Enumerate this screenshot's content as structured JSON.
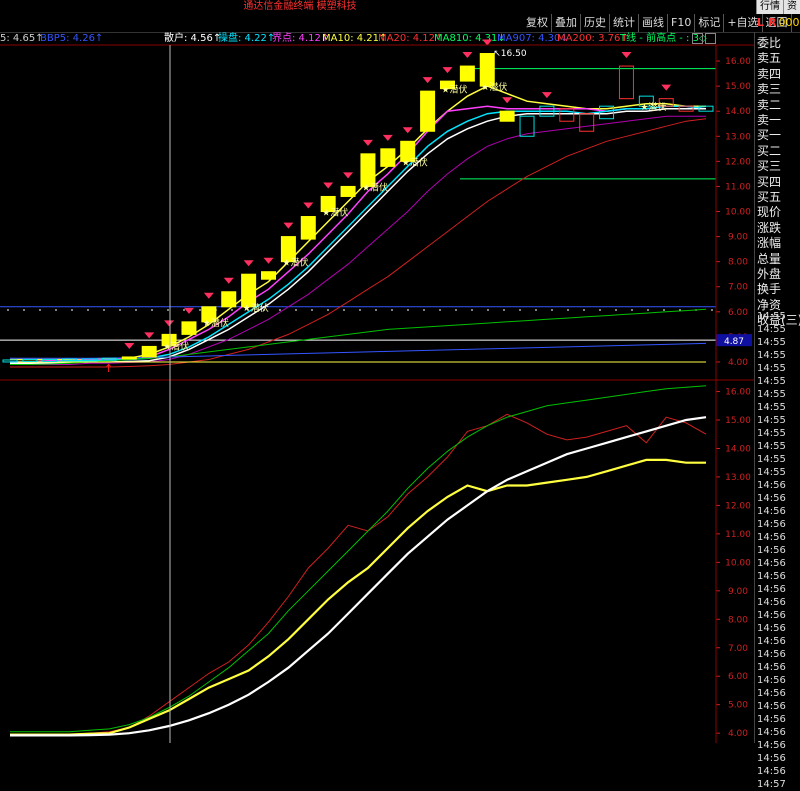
{
  "app_title": "通达信金融终端  模塑科技",
  "top_buttons": [
    "行情",
    "资"
  ],
  "toolbar": {
    "tabs": [
      "复权",
      "叠加",
      "历史",
      "统计",
      "画线",
      "F10",
      "标记",
      "+自选",
      "返回"
    ],
    "l_label": "L",
    "r_label": "R",
    "code": "0007"
  },
  "indicators": [
    {
      "text": "5: 4.65↑",
      "color": "#cccccc"
    },
    {
      "text": "BBP5: 4.26↑",
      "color": "#3355ff"
    },
    {
      "text": "散户: 4.56↑",
      "color": "#ffffff"
    },
    {
      "text": "操盘: 4.22↑",
      "color": "#00e5ff"
    },
    {
      "text": "界点: 4.12↑",
      "color": "#ff40ff"
    },
    {
      "text": "MA10: 4.21↑",
      "color": "#ffff40"
    },
    {
      "text": "MA20: 4.12↑",
      "color": "#ff3030"
    },
    {
      "text": "MA810: 4.31↓",
      "color": "#00ff60"
    },
    {
      "text": "MA907: 4.30↓",
      "color": "#3355ff"
    },
    {
      "text": "MA200: 3.76↑",
      "color": "#ff3030"
    },
    {
      "text": "T线 - 前高点 - : 3◇",
      "color": "#00ff60"
    }
  ],
  "annotations": {
    "peak_label": "16.50",
    "latent_label": "潜伏",
    "price_tag": "4.87"
  },
  "upper_ticks": [
    "16.00",
    "15.00",
    "14.00",
    "13.00",
    "12.00",
    "11.00",
    "10.00",
    "9.00",
    "8.00",
    "7.00",
    "6.00",
    "5.00",
    "4.00"
  ],
  "lower_ticks": [
    "16.00",
    "15.00",
    "14.00",
    "13.00",
    "12.00",
    "11.00",
    "10.00",
    "9.00",
    "8.00",
    "7.00",
    "6.00",
    "5.00",
    "4.00"
  ],
  "side_labels": [
    "委比",
    "卖五",
    "卖四",
    "卖三",
    "卖二",
    "卖一",
    "买一",
    "买二",
    "买三",
    "买四",
    "买五",
    "现价",
    "涨跌",
    "涨幅",
    "总量",
    "外盘",
    "换手",
    "净资",
    "收益(三)"
  ],
  "ticks_list": [
    "14:55",
    "14:55",
    "14:55",
    "14:55",
    "14:55",
    "14:55",
    "14:55",
    "14:55",
    "14:55",
    "14:55",
    "14:55",
    "14:55",
    "14:55",
    "14:56",
    "14:56",
    "14:56",
    "14:56",
    "14:56",
    "14:56",
    "14:56",
    "14:56",
    "14:56",
    "14:56",
    "14:56",
    "14:56",
    "14:56",
    "14:56",
    "14:56",
    "14:56",
    "14:56",
    "14:56",
    "14:56",
    "14:56",
    "14:56",
    "14:56",
    "14:56",
    "14:57"
  ],
  "chart_data": {
    "type": "line",
    "upper": {
      "ylim": [
        3.6,
        16.6
      ],
      "x": [
        0,
        1,
        2,
        3,
        4,
        5,
        6,
        7,
        8,
        9,
        10,
        11,
        12,
        13,
        14,
        15,
        16,
        17,
        18,
        19,
        20,
        21,
        22,
        23,
        24,
        25,
        26,
        27,
        28,
        29,
        30,
        31,
        32,
        33,
        34,
        35
      ],
      "candles": [
        {
          "o": 4.05,
          "c": 4.08
        },
        {
          "o": 4.1,
          "c": 4.1
        },
        {
          "o": 4.08,
          "c": 4.1
        },
        {
          "o": 4.1,
          "c": 4.12
        },
        {
          "o": 4.1,
          "c": 4.12
        },
        {
          "o": 4.12,
          "c": 4.15
        },
        {
          "o": 4.15,
          "c": 4.2
        },
        {
          "o": 4.2,
          "c": 4.62
        },
        {
          "o": 4.65,
          "c": 5.1
        },
        {
          "o": 5.1,
          "c": 5.6
        },
        {
          "o": 5.6,
          "c": 6.2
        },
        {
          "o": 6.2,
          "c": 6.8
        },
        {
          "o": 6.2,
          "c": 7.5
        },
        {
          "o": 7.3,
          "c": 7.6
        },
        {
          "o": 8.0,
          "c": 9.0
        },
        {
          "o": 8.9,
          "c": 9.8
        },
        {
          "o": 10.0,
          "c": 10.6
        },
        {
          "o": 10.6,
          "c": 11.0
        },
        {
          "o": 11.0,
          "c": 12.3
        },
        {
          "o": 11.8,
          "c": 12.5
        },
        {
          "o": 12.0,
          "c": 12.8
        },
        {
          "o": 13.2,
          "c": 14.8
        },
        {
          "o": 14.9,
          "c": 15.2
        },
        {
          "o": 15.2,
          "c": 15.8
        },
        {
          "o": 15.0,
          "c": 16.3
        },
        {
          "o": 13.6,
          "c": 14.0
        },
        {
          "o": 13.0,
          "c": 13.8
        },
        {
          "o": 13.8,
          "c": 14.2
        },
        {
          "o": 14.1,
          "c": 13.6
        },
        {
          "o": 13.9,
          "c": 13.2
        },
        {
          "o": 13.7,
          "c": 14.2
        },
        {
          "o": 15.8,
          "c": 14.5
        },
        {
          "o": 14.2,
          "c": 14.6
        },
        {
          "o": 14.5,
          "c": 14.2
        },
        {
          "o": 14.2,
          "c": 14.0
        },
        {
          "o": 14.0,
          "c": 14.2
        }
      ],
      "series": [
        {
          "color": "#ffff40",
          "values": [
            4.1,
            4.1,
            4.1,
            4.1,
            4.1,
            4.12,
            4.15,
            4.3,
            4.6,
            5.0,
            5.5,
            6.1,
            6.7,
            7.2,
            8.0,
            8.8,
            9.6,
            10.4,
            11.2,
            11.8,
            12.5,
            13.3,
            14.0,
            14.6,
            15.0,
            14.7,
            14.4,
            14.3,
            14.2,
            14.1,
            14.1,
            14.2,
            14.3,
            14.3,
            14.2,
            14.2
          ]
        },
        {
          "color": "#ff40ff",
          "values": [
            4.0,
            4.0,
            4.05,
            4.05,
            4.08,
            4.1,
            4.12,
            4.2,
            4.5,
            4.9,
            5.3,
            5.8,
            6.4,
            6.9,
            7.6,
            8.3,
            9.1,
            9.9,
            10.8,
            11.5,
            12.3,
            13.2,
            14.0,
            14.1,
            14.2,
            14.1,
            14.1,
            14.1,
            14.1,
            14.1,
            14.0,
            14.1,
            14.1,
            14.2,
            14.2,
            14.1
          ]
        },
        {
          "color": "#00e5ff",
          "values": [
            4.0,
            4.0,
            4.0,
            4.05,
            4.05,
            4.08,
            4.1,
            4.15,
            4.3,
            4.6,
            5.0,
            5.5,
            6.0,
            6.5,
            7.1,
            7.8,
            8.6,
            9.4,
            10.2,
            11.0,
            11.8,
            12.6,
            13.2,
            13.6,
            13.9,
            14.0,
            14.0,
            14.0,
            14.0,
            13.9,
            14.0,
            14.1,
            14.1,
            14.2,
            14.2,
            14.1
          ]
        },
        {
          "color": "#ffffff",
          "values": [
            3.95,
            3.95,
            3.95,
            3.98,
            4.0,
            4.0,
            4.02,
            4.05,
            4.2,
            4.5,
            4.9,
            5.3,
            5.8,
            6.3,
            6.9,
            7.6,
            8.4,
            9.2,
            10.0,
            10.8,
            11.6,
            12.3,
            12.9,
            13.3,
            13.6,
            13.8,
            13.9,
            13.9,
            13.9,
            13.9,
            13.9,
            14.0,
            14.0,
            14.1,
            14.1,
            14.1
          ]
        },
        {
          "color": "#b000b0",
          "values": [
            3.9,
            3.9,
            3.9,
            3.9,
            3.95,
            3.95,
            3.98,
            4.0,
            4.1,
            4.3,
            4.6,
            4.9,
            5.3,
            5.7,
            6.2,
            6.7,
            7.3,
            7.9,
            8.6,
            9.3,
            10.0,
            10.8,
            11.5,
            12.1,
            12.6,
            12.9,
            13.1,
            13.2,
            13.3,
            13.4,
            13.5,
            13.6,
            13.7,
            13.8,
            13.8,
            13.8
          ]
        },
        {
          "color": "#d02020",
          "values": [
            3.8,
            3.8,
            3.8,
            3.8,
            3.8,
            3.8,
            3.82,
            3.85,
            3.9,
            4.0,
            4.1,
            4.3,
            4.5,
            4.8,
            5.1,
            5.5,
            5.9,
            6.4,
            6.9,
            7.4,
            8.0,
            8.6,
            9.2,
            9.8,
            10.4,
            10.9,
            11.4,
            11.8,
            12.2,
            12.5,
            12.8,
            13.0,
            13.2,
            13.4,
            13.6,
            13.7
          ]
        },
        {
          "color": "#00c000",
          "values": [
            3.9,
            3.9,
            3.92,
            3.95,
            4.0,
            4.05,
            4.1,
            4.15,
            4.2,
            4.3,
            4.4,
            4.5,
            4.6,
            4.7,
            4.8,
            4.9,
            5.0,
            5.1,
            5.2,
            5.3,
            5.35,
            5.4,
            5.45,
            5.5,
            5.55,
            5.6,
            5.65,
            5.7,
            5.75,
            5.8,
            5.85,
            5.9,
            5.95,
            6.0,
            6.05,
            6.1
          ]
        },
        {
          "color": "#3355ff",
          "values": [
            4.15,
            4.15,
            4.15,
            4.15,
            4.15,
            4.16,
            4.17,
            4.18,
            4.2,
            4.22,
            4.24,
            4.26,
            4.28,
            4.3,
            4.32,
            4.34,
            4.36,
            4.38,
            4.4,
            4.42,
            4.44,
            4.46,
            4.48,
            4.5,
            4.52,
            4.54,
            4.56,
            4.58,
            4.6,
            4.62,
            4.64,
            4.66,
            4.68,
            4.7,
            4.72,
            4.74
          ]
        },
        {
          "color": "#ffff40",
          "values": [
            4.0,
            4.0,
            4.0,
            4.0,
            4.0,
            4.0,
            4.0,
            4.0,
            4.0,
            4.0,
            4.0,
            4.0,
            4.0,
            4.0,
            4.0,
            4.0,
            4.0,
            4.0,
            4.0,
            4.0,
            4.0,
            4.0,
            4.0,
            4.0,
            4.0,
            4.0,
            4.0,
            4.0,
            4.0,
            4.0,
            4.0,
            4.0,
            4.0,
            4.0,
            4.0,
            4.0
          ]
        }
      ],
      "hlines": [
        {
          "y": 15.7,
          "color": "#00ff60"
        },
        {
          "y": 11.3,
          "color": "#00ff60"
        },
        {
          "y": 6.2,
          "color": "#3355ff"
        },
        {
          "y": 4.87,
          "color": "#ffffff"
        }
      ],
      "triangles": [
        6,
        7,
        8,
        9,
        10,
        11,
        12,
        13,
        14,
        15,
        16,
        17,
        18,
        19,
        20,
        21,
        22,
        23,
        24,
        25,
        27,
        31,
        33
      ]
    },
    "lower": {
      "ylim": [
        3.9,
        16.3
      ],
      "series": [
        {
          "color": "#d02020",
          "values": [
            3.95,
            3.95,
            3.95,
            3.97,
            4.0,
            4.05,
            4.2,
            4.6,
            5.1,
            5.6,
            6.1,
            6.5,
            7.1,
            7.9,
            8.8,
            9.8,
            10.5,
            11.3,
            11.1,
            11.6,
            12.4,
            13.0,
            13.7,
            14.6,
            14.8,
            15.2,
            14.9,
            14.5,
            14.3,
            14.4,
            14.6,
            14.8,
            14.2,
            15.1,
            14.9,
            14.5
          ]
        },
        {
          "color": "#00c000",
          "values": [
            4.05,
            4.05,
            4.05,
            4.05,
            4.1,
            4.15,
            4.3,
            4.55,
            4.9,
            5.3,
            5.8,
            6.3,
            6.9,
            7.5,
            8.3,
            9.0,
            9.7,
            10.4,
            11.1,
            11.8,
            12.6,
            13.3,
            13.9,
            14.4,
            14.8,
            15.1,
            15.3,
            15.5,
            15.6,
            15.7,
            15.8,
            15.9,
            16.0,
            16.1,
            16.15,
            16.2
          ]
        },
        {
          "color": "#ffff40",
          "values": [
            3.95,
            3.95,
            3.95,
            3.95,
            3.98,
            4.0,
            4.2,
            4.5,
            4.8,
            5.2,
            5.6,
            5.9,
            6.2,
            6.7,
            7.3,
            8.0,
            8.7,
            9.3,
            9.8,
            10.5,
            11.2,
            11.8,
            12.3,
            12.7,
            12.5,
            12.7,
            12.7,
            12.8,
            12.9,
            13.0,
            13.2,
            13.4,
            13.6,
            13.6,
            13.5,
            13.5
          ]
        },
        {
          "color": "#ffffff",
          "values": [
            3.92,
            3.92,
            3.92,
            3.92,
            3.93,
            3.95,
            4.0,
            4.1,
            4.25,
            4.45,
            4.7,
            5.0,
            5.35,
            5.8,
            6.3,
            6.9,
            7.5,
            8.2,
            8.9,
            9.6,
            10.3,
            10.9,
            11.5,
            12.0,
            12.5,
            12.9,
            13.2,
            13.5,
            13.8,
            14.0,
            14.2,
            14.4,
            14.6,
            14.8,
            15.0,
            15.1
          ]
        }
      ]
    }
  }
}
